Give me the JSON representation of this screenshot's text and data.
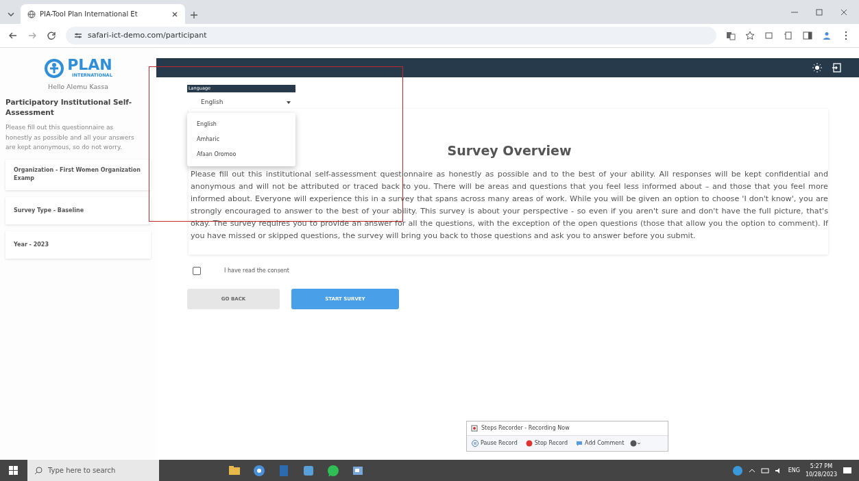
{
  "browser": {
    "tab_title": "PIA-Tool Plan International Et",
    "url": "safari-ict-demo.com/participant"
  },
  "sidebar": {
    "logo_text": "PLAN",
    "logo_subtext": "INTERNATIONAL",
    "greeting": "Hello Alemu Kassa",
    "title": "Participatory Institutional Self-Assessment",
    "description": "Please fill out this questionnaire as honestly as possible and all your answers are kept anonymous, so do not worry.",
    "info_items": [
      "Organization - First Women Organization Examp",
      "Survey Type - Baseline",
      "Year - 2023"
    ]
  },
  "language": {
    "label": "Language",
    "value": "English",
    "options": [
      "English",
      "Amharic",
      "Afaan Oromoo"
    ]
  },
  "survey": {
    "title": "Survey Overview",
    "text": "Please fill out this institutional self-assessment questionnaire as honestly as possible and to the best of your ability. All responses will be kept confidential and anonymous and will not be attributed or traced back to you. There will be areas and questions that you feel less informed about – and those that you feel more informed about. Everyone will experience this in a survey that spans across many areas of work. While you will be given an option to choose 'I don't know', you are strongly encouraged to answer to the best of your ability. This survey is about your perspective - so even if you aren't sure and don't have the full picture, that's okay. The survey requires you to provide an answer for all the questions, with the exception of the open questions (those that allow you the option to comment). If you have missed or skipped questions, the survey will bring you back to those questions and ask you to answer before you submit."
  },
  "consent": {
    "label": "I have read the consent",
    "checked": false
  },
  "buttons": [
    {
      "label": "GO BACK",
      "kind": "secondary"
    },
    {
      "label": "START SURVEY",
      "kind": "primary"
    }
  ],
  "steps_recorder": {
    "title": "Steps Recorder - Recording Now",
    "actions": [
      {
        "label": "Pause Record",
        "kind": "pause"
      },
      {
        "label": "Stop Record",
        "kind": "stop"
      },
      {
        "label": "Add Comment",
        "kind": "comment"
      }
    ]
  },
  "taskbar": {
    "search_placeholder": "Type here to search",
    "language": "ENG",
    "time": "5:27 PM",
    "date": "10/28/2023"
  }
}
